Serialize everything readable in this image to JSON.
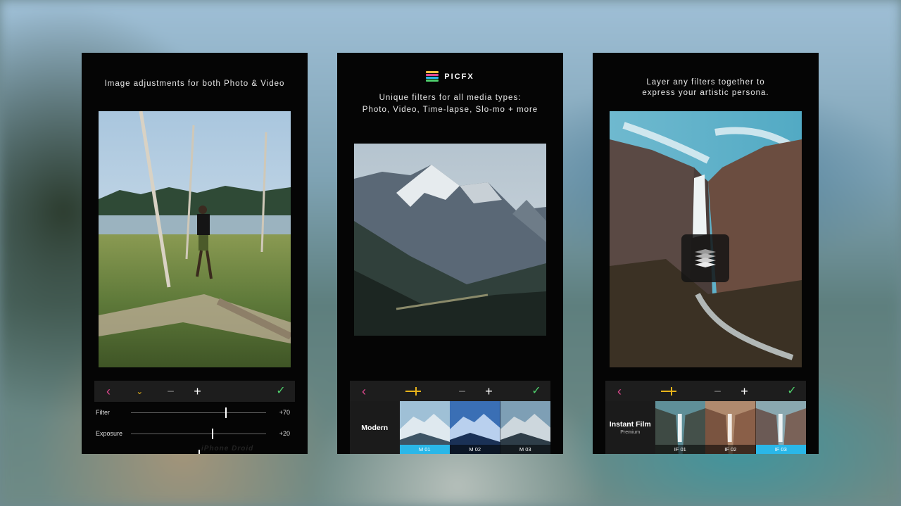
{
  "colors": {
    "accent_pink": "#e0488f",
    "accent_yellow": "#e7b31a",
    "accent_green": "#4fd06d",
    "selected_blue": "#2ab7e8"
  },
  "panels": [
    {
      "caption": "Image adjustments for both Photo & Video",
      "adjustments": [
        {
          "label": "Filter",
          "value": "+70",
          "level": 0.7
        },
        {
          "label": "Exposure",
          "value": "+20",
          "level": 0.6
        }
      ]
    },
    {
      "brand": "PICFX",
      "caption_line1": "Unique filters for all media types:",
      "caption_line2": "Photo, Video, Time-lapse, Slo-mo + more",
      "category": "Modern",
      "thumbs": [
        "M 01",
        "M 02",
        "M 03"
      ],
      "selected_thumb": 0
    },
    {
      "caption_line1": "Layer any filters together to",
      "caption_line2": "express your artistic persona.",
      "category": "Instant Film",
      "category_sub": "Premium",
      "thumbs": [
        "IF 01",
        "IF 02",
        "IF 03"
      ],
      "selected_thumb": 2
    }
  ],
  "toolbar": {
    "back_icon": "chevron-left-icon",
    "check_icon": "check-icon",
    "minus": "−",
    "plus": "+"
  },
  "watermark": "iPhone Droid"
}
